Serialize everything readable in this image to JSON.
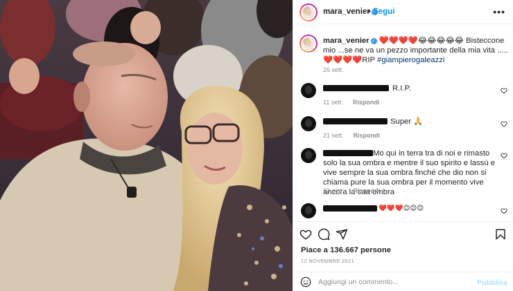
{
  "post": {
    "username": "mara_venier",
    "follow_label": "Segui",
    "more_glyph": "•••",
    "separator": "•",
    "verified_glyph": "✓"
  },
  "caption": {
    "username": "mara_venier",
    "emojis_start": "❤️❤️❤️❤️😂😂😂😂😂",
    "text": " Bisteccone mio ...se ne va un pezzo importante della mia vita .....❤️❤️❤️❤️RIP",
    "hashtag": "#giampierogaleazzi",
    "time": "26 sett."
  },
  "comments": [
    {
      "text": "R.I.P.",
      "time": "11 sett.",
      "reply_label": "Rispondi"
    },
    {
      "text": "Super 🙏",
      "time": "21 sett.",
      "reply_label": "Rispondi"
    },
    {
      "text": "Mo qui in terra tra di noi e rimasto solo la sua ombra e mentre il suo spirito e lassù e vive sempre la sua ombra finché che dio non si chiama pure la sua ombra per il momento vive ancora la sua ombra",
      "time": "23 sett.",
      "reply_label": "Rispondi"
    },
    {
      "text": "❤️❤️❤️😊😊😊",
      "time": "",
      "reply_label": ""
    }
  ],
  "actions": {
    "likes": "Piace a 136.667 persone",
    "date": "12 NOVEMBRE 2021",
    "comment_placeholder": "Aggiungi un commento...",
    "publish_label": "Pubblica"
  },
  "colors": {
    "accent": "#0095f6",
    "publish_disabled": "#b2dffc",
    "muted": "#8e8e8e"
  },
  "icons": [
    "heart-icon",
    "comment-icon",
    "share-icon",
    "bookmark-icon",
    "emoji-icon",
    "more-icon",
    "verified-icon"
  ]
}
